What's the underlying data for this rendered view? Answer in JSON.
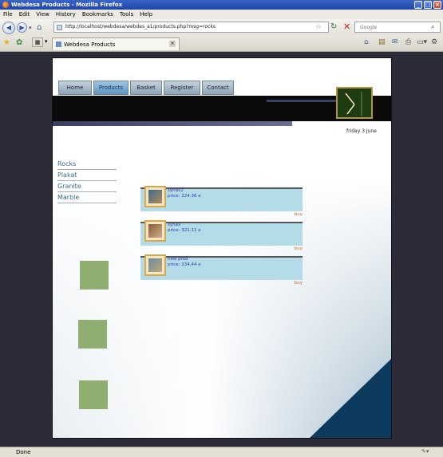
{
  "window": {
    "title": "Webdesa Products - Mozilla Firefox"
  },
  "menu": [
    "File",
    "Edit",
    "View",
    "History",
    "Bookmarks",
    "Tools",
    "Help"
  ],
  "address_bar": {
    "url": "http://localhost/webdesa/webdes_a1/products.php?msg=rocks"
  },
  "search": {
    "placeholder": "Google"
  },
  "tab": {
    "label": "Webdesa Products"
  },
  "site": {
    "nav": [
      "Home",
      "Products",
      "Basket",
      "Register",
      "Contact"
    ],
    "active_nav": "Products",
    "date": "friday 3 June",
    "categories": [
      "Rocks",
      "Plakat",
      "Granite",
      "Marble"
    ],
    "products": [
      {
        "name": "synax2",
        "price": "price: 224.36 e",
        "buy": "buy"
      },
      {
        "name": "synax",
        "price": "price: 321.11 e",
        "buy": "buy"
      },
      {
        "name": "new prod",
        "price": "price: 234.44 e",
        "buy": "buy"
      }
    ]
  },
  "status": {
    "text": "Done"
  },
  "colors": {
    "titlebar": "#1f46a6",
    "product_bar": "#b3dbe8",
    "buy_link": "#d2691e",
    "green_square": "#8fae6f",
    "corner_triangle": "#0c3a5c"
  }
}
